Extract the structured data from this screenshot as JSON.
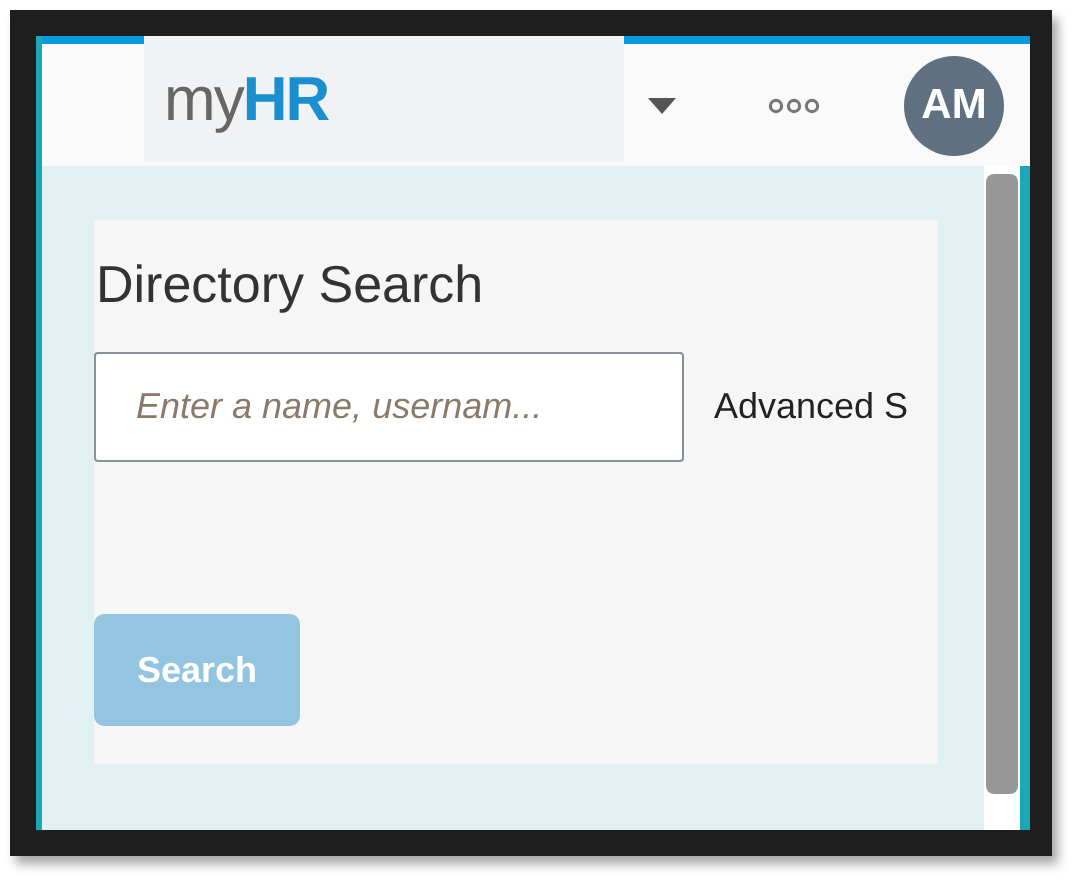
{
  "header": {
    "logo": "my**HR**",
    "avatar": "AM"
  },
  "directory_search": {
    "title": "Directory Search",
    "search_field": {
      "placeholder": "Enter a name, usernam..."
    },
    "advanced_link": "Advanced S",
    "search_button": {
      "label": "Search",
      "disabled": true
    }
  }
}
